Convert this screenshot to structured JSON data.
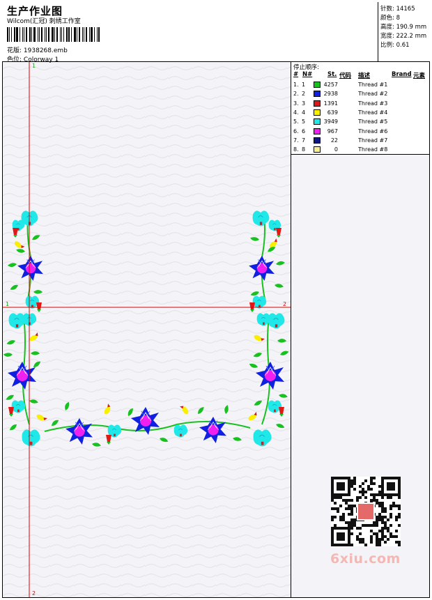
{
  "header": {
    "title": "生产作业图",
    "company": "Wilcom(汇冠) 刺绣工作室",
    "file_label": "花版:",
    "file_name": "1938268.emb",
    "colorway_label": "色位:",
    "colorway": "Colorway 1"
  },
  "stats": [
    {
      "label": "针数:",
      "value": "14165"
    },
    {
      "label": "颜色:",
      "value": "8"
    },
    {
      "label": "高度:",
      "value": "190.9 mm"
    },
    {
      "label": "宽度:",
      "value": "222.2 mm"
    },
    {
      "label": "比例:",
      "value": "0.61"
    }
  ],
  "stop_sequence": {
    "title": "停止顺序:",
    "headers": {
      "idx": "#",
      "no": "N#",
      "st": "St.",
      "code": "代码",
      "desc": "描述",
      "brand": "Brand",
      "element": "元素"
    },
    "rows": [
      {
        "idx": "1.",
        "no": "1",
        "color": "#18c020",
        "st": "4257",
        "desc": "Thread #1"
      },
      {
        "idx": "2.",
        "no": "2",
        "color": "#1020e0",
        "st": "2938",
        "desc": "Thread #2"
      },
      {
        "idx": "3.",
        "no": "3",
        "color": "#e01818",
        "st": "1391",
        "desc": "Thread #3"
      },
      {
        "idx": "4.",
        "no": "4",
        "color": "#f8f000",
        "st": "639",
        "desc": "Thread #4"
      },
      {
        "idx": "5.",
        "no": "5",
        "color": "#20e8e8",
        "st": "3949",
        "desc": "Thread #5"
      },
      {
        "idx": "6.",
        "no": "6",
        "color": "#f020f0",
        "st": "967",
        "desc": "Thread #6"
      },
      {
        "idx": "7.",
        "no": "7",
        "color": "#101880",
        "st": "22",
        "desc": "Thread #7"
      },
      {
        "idx": "8.",
        "no": "8",
        "color": "#f8f090",
        "st": "0",
        "desc": "Thread #8"
      }
    ]
  },
  "guides": {
    "v_top": "1",
    "v_bottom": "2",
    "h_left": "1",
    "h_right": "2"
  },
  "watermark": "6xiu.com",
  "colors": {
    "guide": "#dd0000",
    "leaf": "#18c020",
    "flower_blue": "#1020e0",
    "flower_cyan": "#20e8e8",
    "magenta": "#f020f0",
    "bud_red": "#e01818",
    "bud_yellow": "#f8f000"
  }
}
